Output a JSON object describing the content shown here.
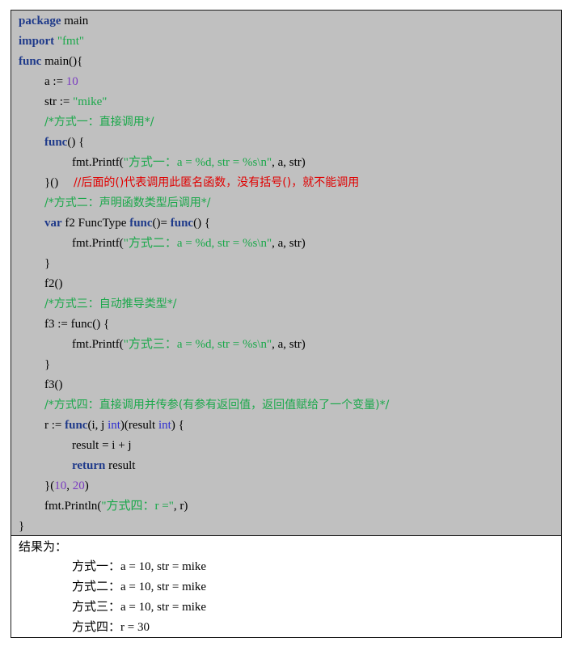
{
  "code": {
    "l1_kw": "package",
    "l1_rest": " main",
    "l2_kw": "import",
    "l2_str": "\"fmt\"",
    "l3_kw": "func",
    "l3_rest": " main(){",
    "l4_pre": "a := ",
    "l4_num": "10",
    "l5_pre": "str := ",
    "l5_str": "\"mike\"",
    "l6_cmt": "/*方式一：直接调用*/",
    "l7_kw": "func",
    "l7_rest": "() {",
    "l8_pre": "fmt.Printf(",
    "l8_str": "\"方式一：a = %d, str = %s\\n\"",
    "l8_post": ", a, str)",
    "l9_pre": "}()     ",
    "l9_cmt": "//后面的()代表调用此匿名函数，没有括号()，就不能调用",
    "l10_cmt": "/*方式二：声明函数类型后调用*/",
    "l11_kw1": "var",
    "l11_mid1": " f2 FuncType ",
    "l11_kw2": "func",
    "l11_mid2": "()= ",
    "l11_kw3": "func",
    "l11_post": "() {",
    "l12_pre": "fmt.Printf(",
    "l12_str": "\"方式二：a = %d, str = %s\\n\"",
    "l12_post": ", a, str)",
    "l13": "}",
    "l14": "f2()",
    "l15_cmt": "/*方式三：自动推导类型*/",
    "l16": "f3 := func() {",
    "l17_pre": "fmt.Printf(",
    "l17_str": "\"方式三：a = %d, str = %s\\n\"",
    "l17_post": ", a, str)",
    "l18": "}",
    "l19": "f3()",
    "l20_cmt": "/*方式四：直接调用并传参(有参有返回值，返回值赋给了一个变量)*/",
    "l21_pre": "r := ",
    "l21_kw": "func",
    "l21_mid": "(i, j ",
    "l21_int1": "int",
    "l21_mid2": ")(result ",
    "l21_int2": "int",
    "l21_post": ") {",
    "l22": "result = i + j",
    "l23_kw": "return",
    "l23_rest": " result",
    "l24_pre": "}(",
    "l24_n1": "10",
    "l24_sep": ", ",
    "l24_n2": "20",
    "l24_post": ")",
    "l25_pre": "fmt.Println(",
    "l25_str": "\"方式四：r =\"",
    "l25_post": ", r)",
    "l26": "}"
  },
  "result": {
    "label": "结果为：",
    "lines": [
      "方式一：a = 10, str = mike",
      "方式二：a = 10, str = mike",
      "方式三：a = 10, str = mike",
      "方式四：r = 30"
    ]
  }
}
